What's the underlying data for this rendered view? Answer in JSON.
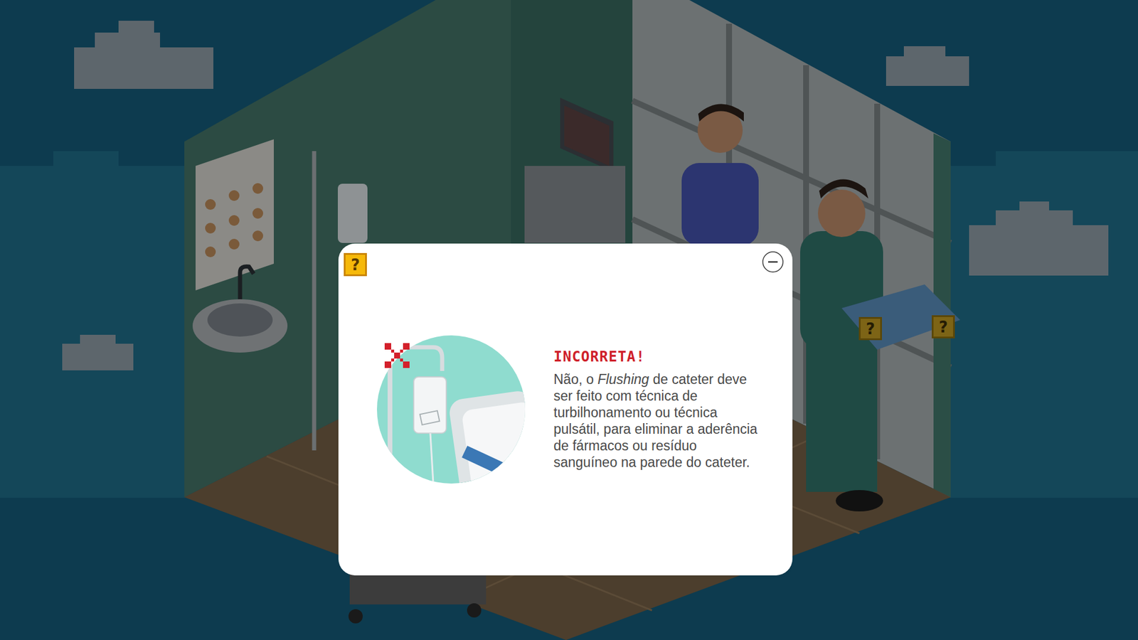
{
  "dialog": {
    "result": "INCORRETA!",
    "correct": false,
    "message": [
      {
        "text": "Não, o ",
        "italic": false
      },
      {
        "text": "Flushing",
        "italic": true
      },
      {
        "text": " de cateter deve ser feito com técnica de turbilhonamento ou técnica pulsátil, para eliminar a aderência de fármacos ou resíduo sanguíneo na parede do cateter.",
        "italic": false
      }
    ]
  },
  "hints": [
    {
      "label": "?",
      "dimmed": false
    },
    {
      "label": "?",
      "dimmed": true
    },
    {
      "label": "?",
      "dimmed": true
    }
  ]
}
